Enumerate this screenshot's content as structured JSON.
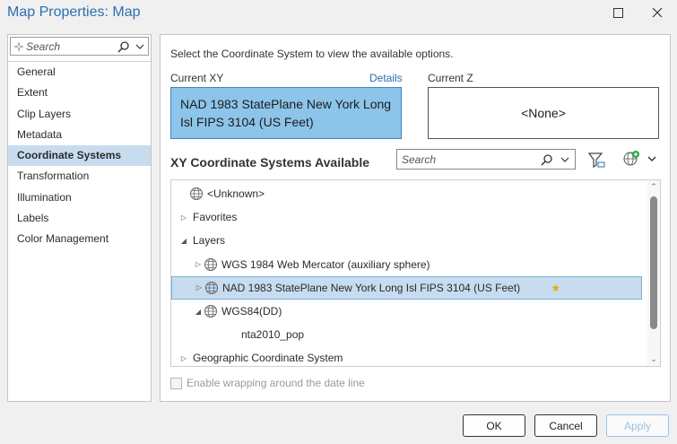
{
  "window": {
    "title": "Map Properties: Map"
  },
  "left": {
    "search_placeholder": "Search",
    "nav": [
      {
        "label": "General",
        "active": false
      },
      {
        "label": "Extent",
        "active": false
      },
      {
        "label": "Clip Layers",
        "active": false
      },
      {
        "label": "Metadata",
        "active": false
      },
      {
        "label": "Coordinate Systems",
        "active": true
      },
      {
        "label": "Transformation",
        "active": false
      },
      {
        "label": "Illumination",
        "active": false
      },
      {
        "label": "Labels",
        "active": false
      },
      {
        "label": "Color Management",
        "active": false
      }
    ]
  },
  "main": {
    "instruction": "Select the Coordinate System to view the available options.",
    "current_xy_label": "Current XY",
    "details_link": "Details",
    "current_xy_value": "NAD 1983 StatePlane New York Long Isl FIPS 3104 (US Feet)",
    "current_z_label": "Current Z",
    "current_z_value": "<None>",
    "available_heading": "XY Coordinate Systems Available",
    "search_placeholder": "Search",
    "tree": [
      {
        "label": "<Unknown>",
        "indent": 0,
        "toggle": "",
        "icon": "globe-icon",
        "selected": false
      },
      {
        "label": "Favorites",
        "indent": 0,
        "toggle": "▷",
        "icon": "",
        "selected": false
      },
      {
        "label": "Layers",
        "indent": 0,
        "toggle": "◢",
        "icon": "",
        "selected": false
      },
      {
        "label": "WGS 1984 Web Mercator (auxiliary sphere)",
        "indent": 1,
        "toggle": "▷",
        "icon": "globe-icon",
        "selected": false
      },
      {
        "label": "NAD 1983 StatePlane New York Long Isl FIPS 3104 (US Feet)",
        "indent": 1,
        "toggle": "▷",
        "icon": "globe-icon",
        "selected": true
      },
      {
        "label": "WGS84(DD)",
        "indent": 1,
        "toggle": "◢",
        "icon": "globe-icon",
        "selected": false
      },
      {
        "label": "nta2010_pop",
        "indent": 2,
        "toggle": "",
        "icon": "",
        "selected": false
      },
      {
        "label": "Geographic Coordinate System",
        "indent": 0,
        "toggle": "▷",
        "icon": "",
        "selected": false
      }
    ],
    "wrap_checkbox_label": "Enable wrapping around the date line"
  },
  "buttons": {
    "ok": "OK",
    "cancel": "Cancel",
    "apply": "Apply"
  },
  "colors": {
    "accent": "#2a6fb1",
    "selection": "#c7dcef",
    "current_xy_fill": "#8cc4ea"
  }
}
